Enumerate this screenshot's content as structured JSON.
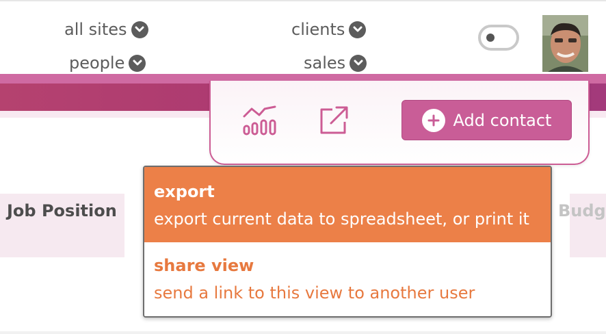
{
  "filters": {
    "all_sites": "all sites",
    "clients": "clients",
    "people": "people",
    "sales": "sales"
  },
  "toolbar": {
    "chart_icon": "bar-chart-icon",
    "export_icon": "external-link-icon",
    "add_contact_label": "Add contact"
  },
  "table": {
    "headers": [
      "Job Position",
      "Budge"
    ]
  },
  "tooltip": {
    "items": [
      {
        "title": "export",
        "description": "export current data to spreadsheet, or print it"
      },
      {
        "title": "share view",
        "description": "send a link to this view to another user"
      }
    ]
  },
  "colors": {
    "accent_pink": "#c95d97",
    "band_magenta": "#a93772",
    "tooltip_orange": "#ec8048",
    "text_gray": "#5c5c5c"
  }
}
